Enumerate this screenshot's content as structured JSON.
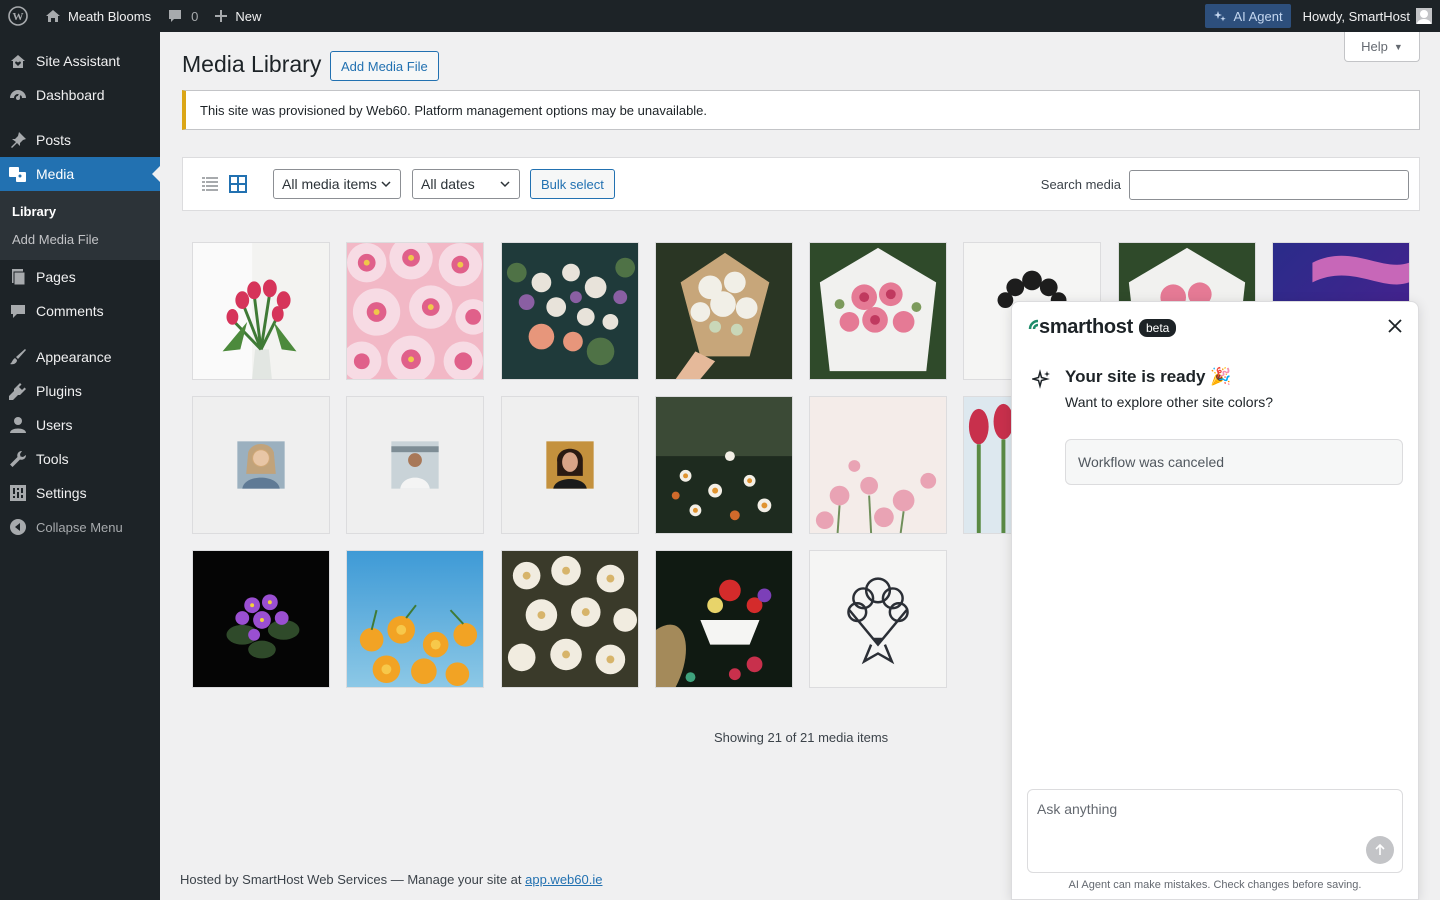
{
  "adminbar": {
    "site_name": "Meath Blooms",
    "comments_count": "0",
    "new_label": "New",
    "ai_agent_label": "AI Agent",
    "howdy": "Howdy, SmartHost"
  },
  "sidebar": {
    "items": [
      {
        "label": "Site Assistant",
        "icon": "house-heart-icon"
      },
      {
        "label": "Dashboard",
        "icon": "dashboard-icon"
      },
      {
        "label": "Posts",
        "icon": "pushpin-icon"
      },
      {
        "label": "Media",
        "icon": "media-icon"
      },
      {
        "label": "Pages",
        "icon": "pages-icon"
      },
      {
        "label": "Comments",
        "icon": "comment-icon"
      },
      {
        "label": "Appearance",
        "icon": "brush-icon"
      },
      {
        "label": "Plugins",
        "icon": "plug-icon"
      },
      {
        "label": "Users",
        "icon": "user-icon"
      },
      {
        "label": "Tools",
        "icon": "wrench-icon"
      },
      {
        "label": "Settings",
        "icon": "sliders-icon"
      },
      {
        "label": "Collapse Menu",
        "icon": "collapse-icon"
      }
    ],
    "submenu": [
      "Library",
      "Add Media File"
    ]
  },
  "main": {
    "help_label": "Help",
    "title": "Media Library",
    "add_button": "Add Media File",
    "notice": "This site was provisioned by Web60. Platform management options may be unavailable.",
    "filter_type": "All media items",
    "filter_date": "All dates",
    "bulk_label": "Bulk select",
    "search_label": "Search media",
    "search_value": "",
    "showing": "Showing 21 of 21 media items",
    "footer_prefix": "Hosted by SmartHost Web Services — Manage your site at ",
    "footer_link": "app.web60.ie"
  },
  "assistant": {
    "brand": "smarthost",
    "badge": "beta",
    "title": "Your site is ready 🎉",
    "subtitle": "Want to explore other site colors?",
    "workflow_status": "Workflow was canceled",
    "input_placeholder": "Ask anything",
    "disclaimer": "AI Agent can make mistakes. Check changes before saving."
  },
  "colors": {
    "accent": "#2271b1",
    "sidebar_bg": "#1d2327",
    "notice_warning": "#dba617"
  }
}
